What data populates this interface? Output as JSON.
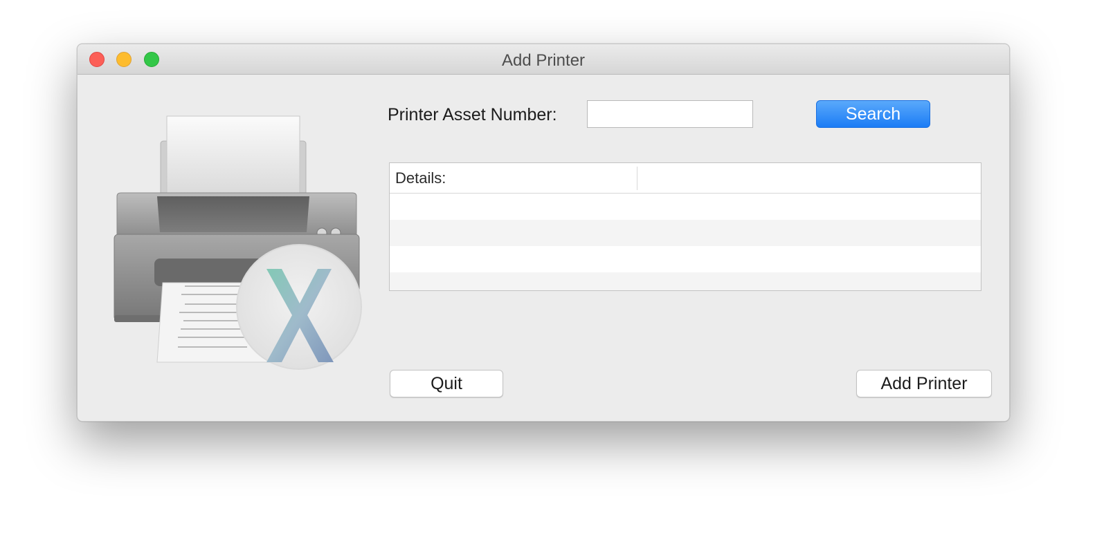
{
  "window": {
    "title": "Add Printer"
  },
  "form": {
    "asset_label": "Printer Asset Number:",
    "asset_value": "",
    "asset_placeholder": "",
    "search_label": "Search"
  },
  "details_table": {
    "columns": [
      "Details:",
      ""
    ],
    "rows": [
      [
        "",
        ""
      ],
      [
        "",
        ""
      ],
      [
        "",
        ""
      ],
      [
        "",
        ""
      ]
    ]
  },
  "footer": {
    "quit_label": "Quit",
    "add_label": "Add Printer"
  },
  "art": {
    "icon": "printer-icon",
    "badge": "os-x-badge-icon",
    "badge_letter": "X"
  },
  "colors": {
    "accent": "#1b7cf5",
    "close": "#fc5f57",
    "minimize": "#fdbc2e",
    "maximize": "#33c748"
  }
}
